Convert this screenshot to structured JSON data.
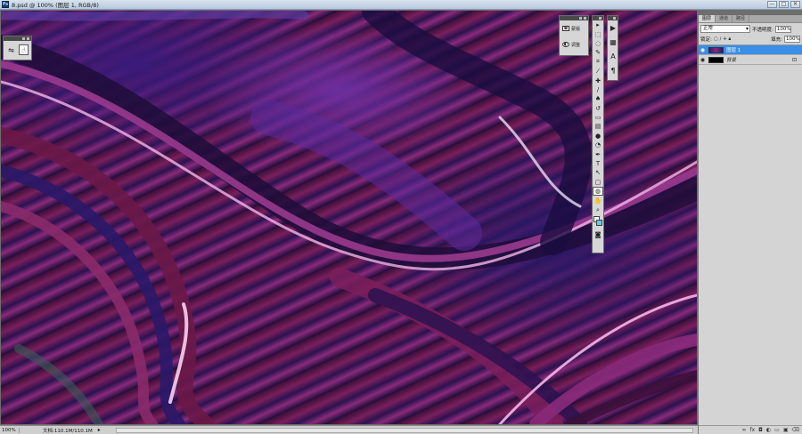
{
  "window": {
    "app_badge": "Ps",
    "title": "8.psd @ 100% (图层 1, RGB/8)",
    "buttons": [
      "—",
      "□",
      "✕"
    ]
  },
  "canvas": {
    "colors": {
      "deep_purple": "#2a1868",
      "magenta": "#8a2a7a",
      "maroon": "#5a1238",
      "highlight": "#f2b7e8",
      "violet": "#6b2e9e"
    }
  },
  "options_panel": {
    "tools": [
      {
        "icon": "adjust-sliders-icon",
        "glyph": "⇋"
      },
      {
        "icon": "puppet-hand-icon",
        "glyph": "☝"
      }
    ]
  },
  "adjustments_panel": {
    "items": [
      {
        "icon": "masks-icon",
        "label": "蒙版"
      },
      {
        "icon": "adjustments-icon",
        "label": "调整"
      }
    ]
  },
  "toolbar": {
    "tools": [
      {
        "icon": "move-tool-icon",
        "glyph": "▸"
      },
      {
        "icon": "marquee-tool-icon",
        "glyph": "⬚"
      },
      {
        "icon": "lasso-tool-icon",
        "glyph": "◌"
      },
      {
        "icon": "quick-select-tool-icon",
        "glyph": "✎"
      },
      {
        "icon": "crop-tool-icon",
        "glyph": "⌗"
      },
      {
        "icon": "eyedropper-tool-icon",
        "glyph": "⁄"
      },
      {
        "icon": "healing-brush-tool-icon",
        "glyph": "✚"
      },
      {
        "icon": "brush-tool-icon",
        "glyph": "∕"
      },
      {
        "icon": "stamp-tool-icon",
        "glyph": "♠"
      },
      {
        "icon": "history-brush-tool-icon",
        "glyph": "↺"
      },
      {
        "icon": "eraser-tool-icon",
        "glyph": "▭"
      },
      {
        "icon": "gradient-tool-icon",
        "glyph": "▤"
      },
      {
        "icon": "blur-tool-icon",
        "glyph": "●"
      },
      {
        "icon": "dodge-tool-icon",
        "glyph": "◔"
      },
      {
        "icon": "pen-tool-icon",
        "glyph": "✒"
      },
      {
        "icon": "type-tool-icon",
        "glyph": "T"
      },
      {
        "icon": "path-select-tool-icon",
        "glyph": "↖"
      },
      {
        "icon": "shape-tool-icon",
        "glyph": "▢"
      },
      {
        "icon": "3d-rotate-tool-icon",
        "glyph": "◍"
      },
      {
        "icon": "hand-tool-icon",
        "glyph": "✋"
      },
      {
        "icon": "zoom-tool-icon",
        "glyph": "⌕"
      }
    ],
    "mask_icon": "quick-mask-icon"
  },
  "side_panel": {
    "items": [
      {
        "icon": "play-actions-icon",
        "glyph": "▶"
      },
      {
        "icon": "layers-comp-icon",
        "glyph": "▦"
      },
      {
        "icon": "character-icon",
        "glyph": "A"
      },
      {
        "icon": "paragraph-icon",
        "glyph": "¶"
      }
    ]
  },
  "layers_panel": {
    "tabs": [
      "图层",
      "通道",
      "路径"
    ],
    "blend_mode": "正常",
    "opacity_label": "不透明度:",
    "opacity_value": "100%",
    "lock_label": "锁定:",
    "fill_label": "填充:",
    "fill_value": "100%",
    "layers": [
      {
        "name": "图层 1",
        "selected": true,
        "thumb": "art",
        "locked": false
      },
      {
        "name": "背景",
        "selected": false,
        "thumb": "black",
        "locked": true
      }
    ],
    "footer_icons": [
      "link-layers-icon",
      "fx-icon",
      "layer-mask-icon",
      "adjustment-layer-icon",
      "group-icon",
      "new-layer-icon",
      "trash-icon"
    ]
  },
  "statusbar": {
    "zoom": "100%",
    "doc_size": "文档:110.1M/110.1M",
    "arrow": "▸"
  }
}
